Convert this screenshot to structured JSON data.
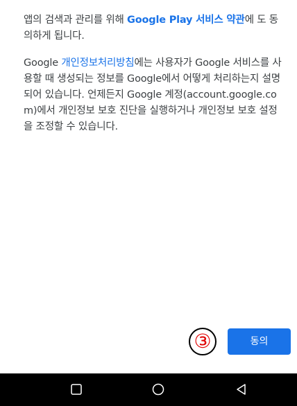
{
  "content": {
    "para1": {
      "before": "앱의 검색과 관리를 위해 ",
      "link": "Google Play 서비스 약관",
      "after": "에 도 동의하게 됩니다."
    },
    "para2": {
      "before": "Google ",
      "link": "개인정보처리방침",
      "after": "에는 사용자가 Google 서비스를 사용할 때 생성되는 정보를 Google에서 어떻게 처리하는지 설명되어 있습니다. 언제든지 Google 계정(account.google.com)에서 개인정보 보호 진단을 실행하거나 개인정보 보호 설정을 조정할 수 있습니다."
    }
  },
  "annotation": {
    "label": "③"
  },
  "footer": {
    "agree_button_label": "동의"
  },
  "navbar": {
    "icons": [
      "recents-icon",
      "home-icon",
      "back-icon"
    ]
  },
  "colors": {
    "link": "#1a73e8",
    "button": "#1a73e8",
    "annotation": "#e00000",
    "navbar": "#000000"
  }
}
